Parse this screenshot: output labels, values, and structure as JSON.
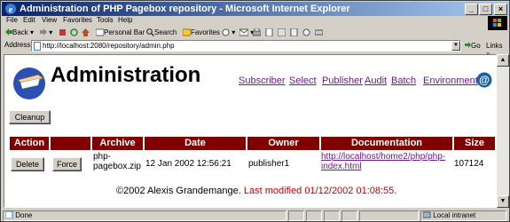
{
  "window": {
    "title": "Administration of PHP Pagebox repository - Microsoft Internet Explorer",
    "minimize": "_",
    "maximize": "□",
    "close": "×"
  },
  "menu": [
    "File",
    "Edit",
    "View",
    "Favorites",
    "Tools",
    "Help"
  ],
  "toolbar": {
    "back": "Back",
    "personal_bar": "Personal Bar",
    "search": "Search",
    "favorites": "Favorites"
  },
  "address": {
    "label": "Address",
    "url": "http://localhost:2080/repository/admin.php",
    "go": "Go",
    "links": "Links"
  },
  "page": {
    "title": "Administration",
    "nav": [
      "Subscriber",
      "Select",
      "Publisher",
      "Audit",
      "Batch",
      "Environment"
    ],
    "cleanup_button": "Cleanup",
    "table": {
      "headers": [
        "Action",
        "Archive",
        "Date",
        "Owner",
        "Documentation",
        "Size"
      ],
      "rows": [
        {
          "delete_button": "Delete",
          "force_button": "Force",
          "archive_line1": "php-",
          "archive_line2": "pagebox.zip",
          "date": "12 Jan 2002 12:56:21",
          "owner": "publisher1",
          "doc_line1": "http://localhost/home2/php/php-",
          "doc_line2": "index.html",
          "size": "107124"
        }
      ]
    },
    "footer": {
      "copyright": "©2002 Alexis Grandemange.",
      "modified": "Last modified 01/12/2002 01:08:55."
    }
  },
  "status": {
    "text": "Done",
    "zone": "Local intranet"
  },
  "colors": {
    "header_bg": "#800000",
    "link": "#6a1b8a",
    "titlebar": "#0a246a"
  }
}
